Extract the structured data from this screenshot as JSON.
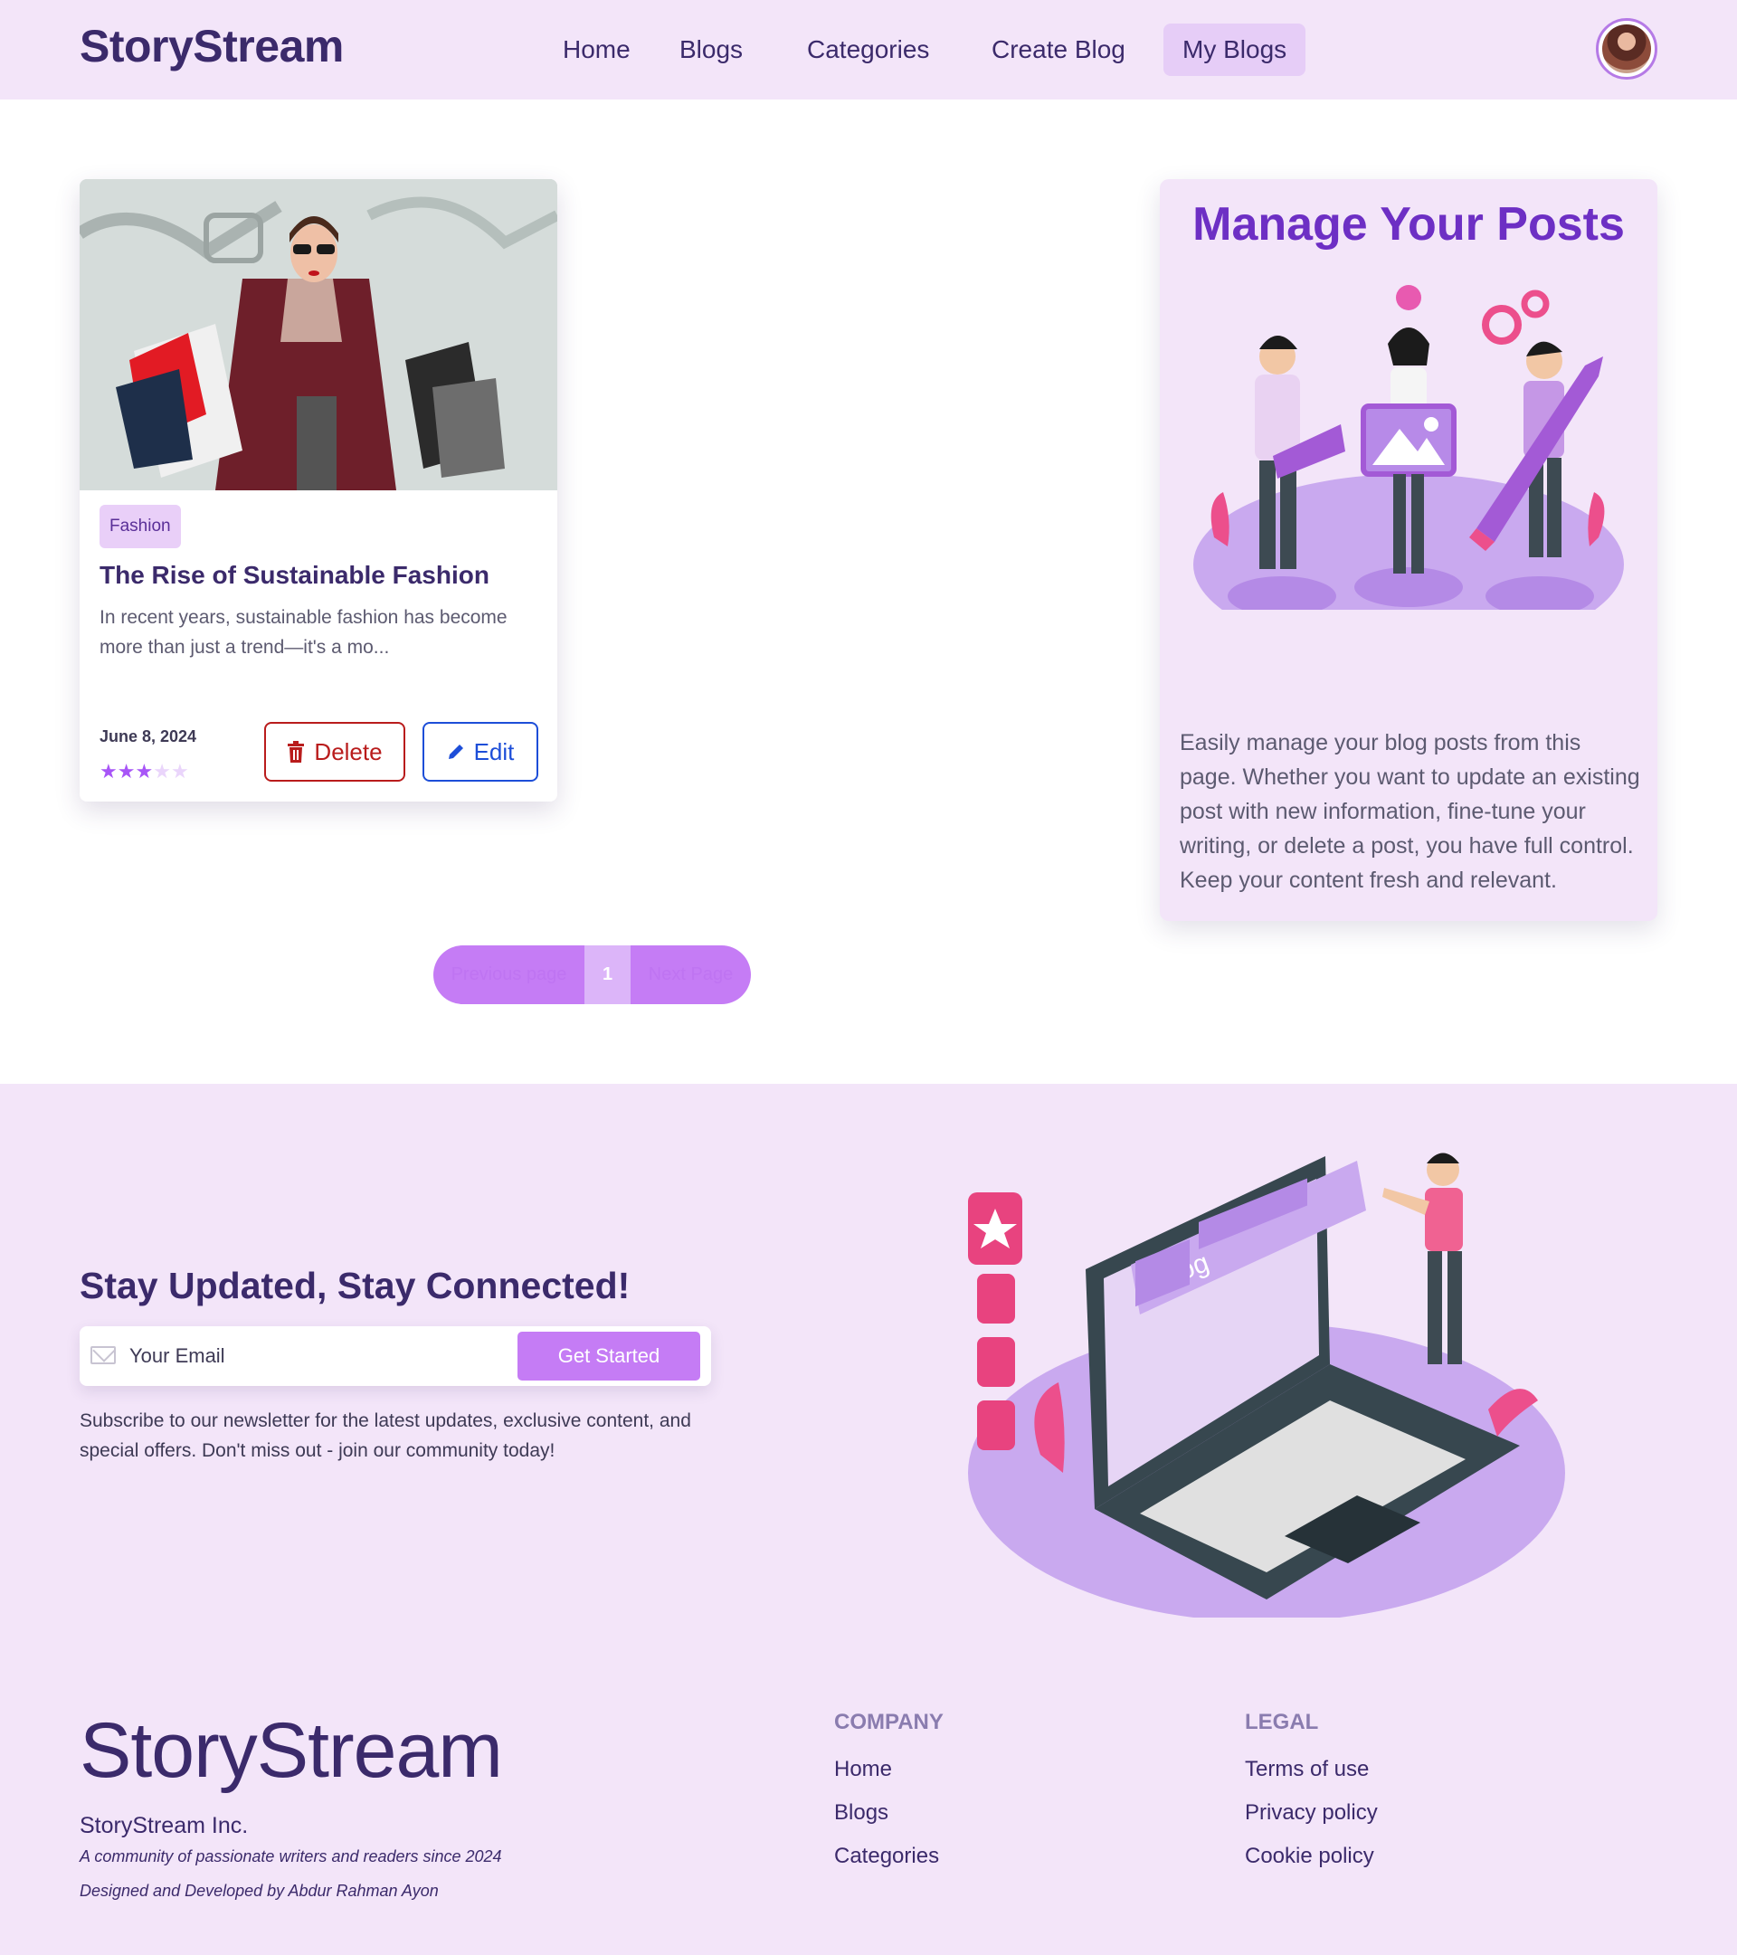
{
  "navbar": {
    "brand": "StoryStream",
    "links": [
      {
        "label": "Home"
      },
      {
        "label": "Blogs"
      },
      {
        "label": "Categories"
      },
      {
        "label": "Create Blog"
      },
      {
        "label": "My Blogs",
        "active": true
      }
    ],
    "avatar_icon": "user-avatar"
  },
  "blog_card": {
    "category": "Fashion",
    "title": "The Rise of Sustainable Fashion",
    "excerpt": "In recent years, sustainable fashion has become more than just a trend—it's a mo...",
    "date": "June 8, 2024",
    "rating": 3,
    "rating_max": 5,
    "delete_label": "Delete",
    "edit_label": "Edit",
    "image_icon": "woman-shopping-bags-photo"
  },
  "manage_panel": {
    "title": "Manage Your Posts",
    "description": "Easily manage your blog posts from this page. Whether you want to update an existing post with new information, fine-tune your writing, or delete a post, you have full control. Keep your content fresh and relevant.",
    "illustration_icon": "team-managing-content-illustration"
  },
  "pagination": {
    "prev_label": "Previous page",
    "current_page": "1",
    "next_label": "Next Page"
  },
  "newsletter": {
    "heading": "Stay Updated, Stay Connected!",
    "email_placeholder": "Your Email",
    "button_label": "Get Started",
    "description": "Subscribe to our newsletter for the latest updates, exclusive content, and special offers. Don't miss out - join our community today!",
    "illustration_text": "blog"
  },
  "footer": {
    "brand": "StoryStream",
    "company_name": "StoryStream Inc.",
    "tagline": "A community of passionate writers and readers since 2024",
    "credit": "Designed and Developed by Abdur Rahman Ayon",
    "columns": [
      {
        "title": "COMPANY",
        "links": [
          "Home",
          "Blogs",
          "Categories"
        ]
      },
      {
        "title": "LEGAL",
        "links": [
          "Terms of use",
          "Privacy policy",
          "Cookie policy"
        ]
      }
    ]
  },
  "colors": {
    "brand": "#3b2a6b",
    "accent": "#c57cf5",
    "panel_bg": "#f3e5f9",
    "delete": "#b91c1c",
    "edit": "#1d4ed8"
  }
}
